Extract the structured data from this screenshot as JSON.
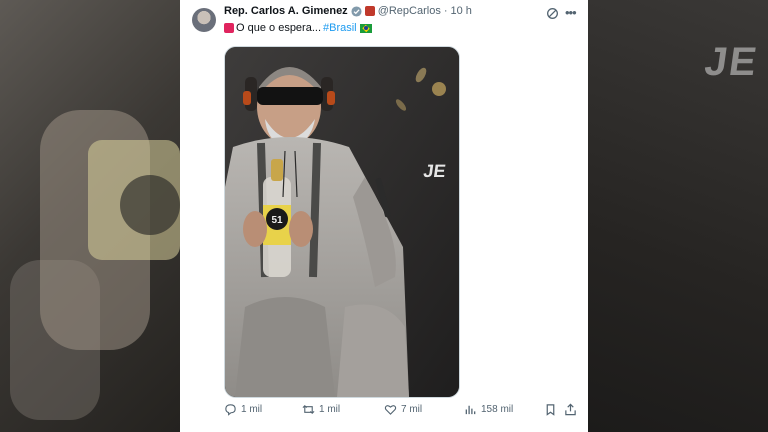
{
  "tweet": {
    "display_name": "Rep. Carlos A. Gimenez",
    "handle": "@RepCarlos",
    "separator": "·",
    "time": "10 h",
    "text": "O que o espera... ",
    "hashtag": "#Brasil",
    "icons": {
      "verified": "verified-check-icon",
      "affiliation": "us-flag-badge-icon",
      "grok": "grok-icon",
      "more": "more-dots-icon",
      "siren": "siren-emoji-icon",
      "flag": "brazil-flag-emoji-icon"
    }
  },
  "media": {
    "bottle_label": "51"
  },
  "actions": {
    "reply_count": "1 mil",
    "repost_count": "1 mil",
    "like_count": "7 mil",
    "views_count": "158 mil"
  },
  "colors": {
    "accent": "#1d9bf0",
    "secondary_text": "#536471",
    "primary_text": "#0f1419"
  }
}
